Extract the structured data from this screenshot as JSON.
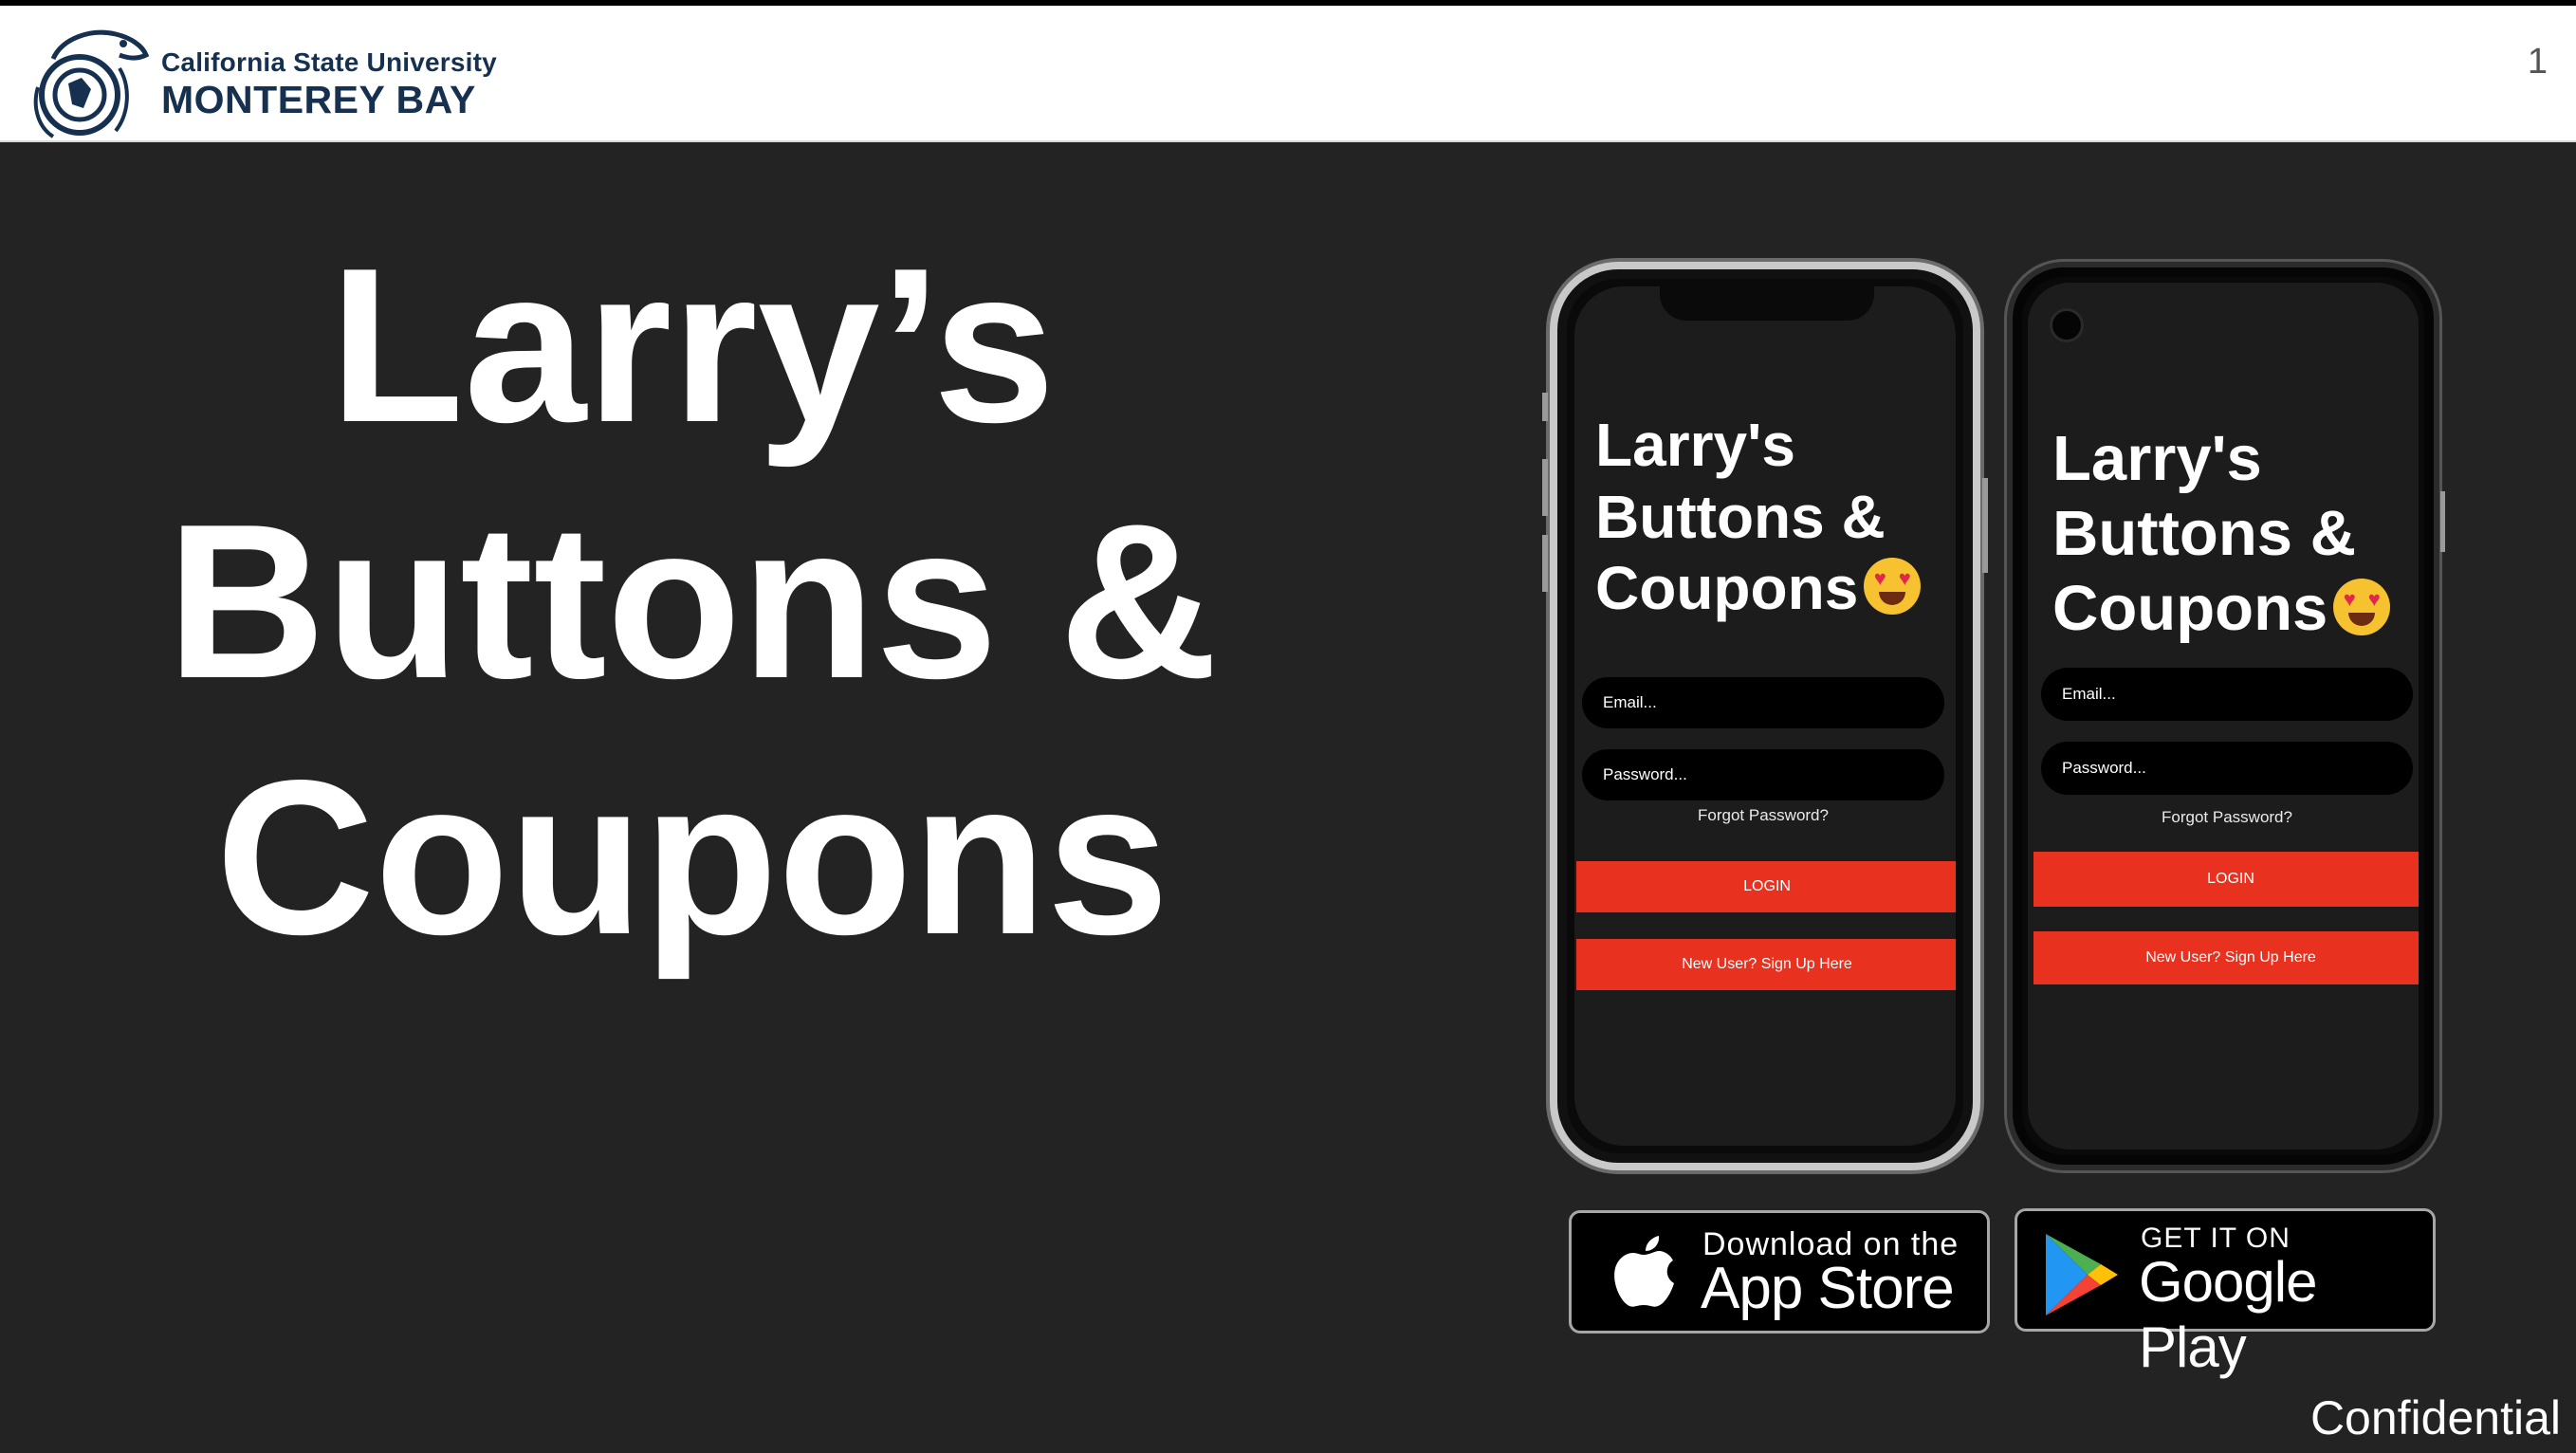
{
  "header": {
    "logo_line1": "California State University",
    "logo_line2": "MONTEREY BAY",
    "slide_number": "1"
  },
  "title": {
    "line1": "Larry’s",
    "line2": "Buttons &",
    "line3": "Coupons"
  },
  "ios_phone": {
    "app_title_line1": "Larry's",
    "app_title_line2": "Buttons &",
    "app_title_line3": "Coupons",
    "email_placeholder": "Email...",
    "password_placeholder": "Password...",
    "forgot_label": "Forgot Password?",
    "login_label": "LOGIN",
    "signup_label": "New User? Sign Up Here"
  },
  "android_phone": {
    "app_title_line1": "Larry's",
    "app_title_line2": "Buttons &",
    "app_title_line3": "Coupons",
    "email_placeholder": "Email...",
    "password_placeholder": "Password...",
    "forgot_label": "Forgot Password?",
    "login_label": "LOGIN",
    "signup_label": "New User? Sign Up Here"
  },
  "badges": {
    "appstore_small": "Download on the",
    "appstore_big": "App Store",
    "googleplay_small": "GET IT ON",
    "googleplay_big": "Google Play"
  },
  "footer": {
    "confidential": "Confidential"
  },
  "colors": {
    "background": "#232323",
    "accent_red": "#e8321f",
    "logo_navy": "#16304f"
  }
}
